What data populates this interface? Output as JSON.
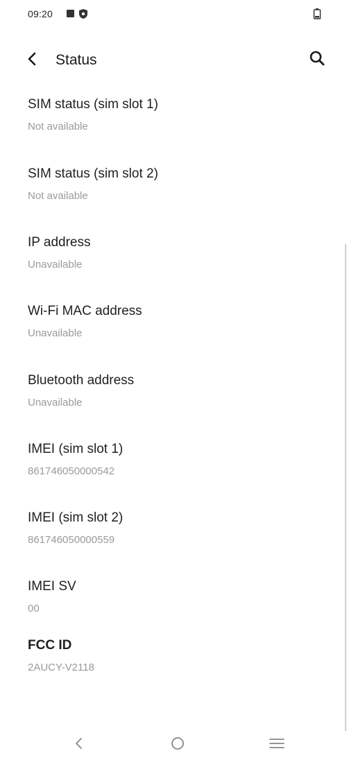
{
  "status_bar": {
    "time": "09:20",
    "icons": [
      "square-notification-icon",
      "shield-icon",
      "battery-icon"
    ]
  },
  "app_bar": {
    "title": "Status",
    "back_icon": "chevron-left-icon",
    "search_icon": "search-icon"
  },
  "items": [
    {
      "title": "SIM status (sim slot 1)",
      "value": "Not available"
    },
    {
      "title": "SIM status (sim slot 2)",
      "value": "Not available"
    },
    {
      "title": "IP address",
      "value": "Unavailable"
    },
    {
      "title": "Wi-Fi MAC address",
      "value": "Unavailable"
    },
    {
      "title": "Bluetooth address",
      "value": "Unavailable"
    },
    {
      "title": "IMEI (sim slot 1)",
      "value": "861746050000542"
    },
    {
      "title": "IMEI (sim slot 2)",
      "value": "861746050000559"
    },
    {
      "title": "IMEI SV",
      "value": "00"
    },
    {
      "title": "FCC ID",
      "value": "2AUCY-V2118"
    }
  ],
  "nav_bar": {
    "icons": [
      "nav-back-icon",
      "nav-home-icon",
      "nav-menu-icon"
    ]
  },
  "colors": {
    "title_text": "#1f1f1f",
    "secondary_text": "#9a9a9a",
    "background": "#ffffff"
  }
}
